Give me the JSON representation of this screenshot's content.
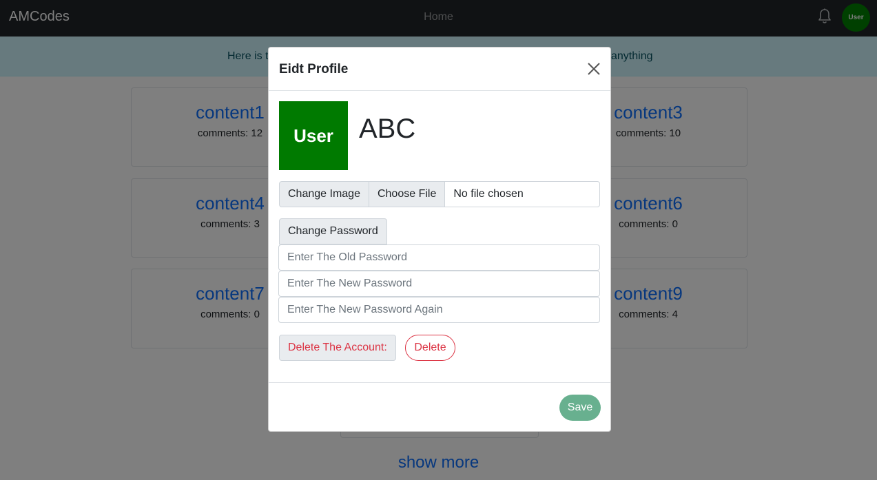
{
  "navbar": {
    "brand": "AMCodes",
    "home_link": "Home",
    "avatar_label": "User"
  },
  "alert": {
    "text_left": "Here is t",
    "text_right": "anything"
  },
  "cards": [
    {
      "title": "content1",
      "comments": "comments: 12"
    },
    {
      "title": "content3",
      "comments": "comments: 10"
    },
    {
      "title": "content4",
      "comments": "comments: 3"
    },
    {
      "title": "content6",
      "comments": "comments: 0"
    },
    {
      "title": "content7",
      "comments": "comments: 0"
    },
    {
      "title": "content9",
      "comments": "comments: 4"
    }
  ],
  "show_more": "show more",
  "modal": {
    "title": "Eidt Profile",
    "profile_image_label": "User",
    "profile_name": "ABC",
    "change_image_label": "Change Image",
    "choose_file_button": "Choose File",
    "no_file_text": "No file chosen",
    "change_password_label": "Change Password",
    "old_password_placeholder": "Enter The Old Password",
    "new_password_placeholder": "Enter The New Password",
    "new_password_again_placeholder": "Enter The New Password Again",
    "delete_account_label": "Delete The Account:",
    "delete_button": "Delete",
    "save_button": "Save"
  },
  "colors": {
    "navbar_bg": "#212529",
    "avatar_bg": "#008000",
    "link_blue": "#0d6efd",
    "danger": "#dc3545",
    "success": "#198754",
    "alert_bg": "#cff4fc"
  },
  "icons": {
    "bell": "bell-icon",
    "close": "close-icon"
  }
}
